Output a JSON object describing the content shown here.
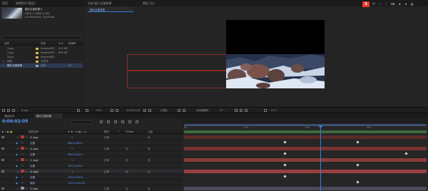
{
  "project": {
    "tab_label": "项目",
    "tab_label2": "效果控件 图层1",
    "thumb_title": "图片过渡效果 ▾",
    "thumb_meta": [
      "1920 × 1080 (1.00)",
      "Δ 0:00:05:00, 25.00 fps"
    ],
    "search_placeholder": "",
    "headers": [
      "名称",
      "类型",
      "大小",
      "帧速率"
    ],
    "items": [
      {
        "name": "1.jpg",
        "type": "ImporteJPG",
        "size": "912 KB",
        "color": "#d9b84f"
      },
      {
        "name": "2.jpg",
        "type": "ImporteJPG",
        "size": "895 KB",
        "color": "#d9b84f"
      },
      {
        "name": "3.jpg",
        "type": "ImporteJPG",
        "size": "",
        "color": "#d9b84f"
      },
      {
        "name": "纯色",
        "type": "文件夹",
        "size": "",
        "color": "#d9b84f"
      },
      {
        "name": "图片过渡效果",
        "type": "合成",
        "size": "25",
        "color": "#9c9cbf"
      }
    ],
    "footer_bpc": "8 bpc"
  },
  "viewer": {
    "tab_label": "合成 图片过渡效果",
    "tab_label2": "图层 (无)",
    "active_tab": "图片过渡效果",
    "brand_logo": "S",
    "toolbar": {
      "zoom": "50%",
      "timecode": "0:00:02:05",
      "resolution": "(完整)",
      "camera": "活动摄像机",
      "view": "1个...",
      "exposure": "+0.0"
    }
  },
  "timeline": {
    "tab_label": "渲染队列",
    "active_tab": "图片过渡效果",
    "timecode": "0:00:02:05",
    "headers": [
      "图层名称",
      "模式",
      "T",
      "TrkMat",
      "父级"
    ],
    "layers": [
      {
        "num": "1",
        "name": "[2.jpg]",
        "mode": "正常",
        "trk": "",
        "parent": "无",
        "type": "layer"
      },
      {
        "name": "位置",
        "value": "960.0,960.0",
        "type": "prop"
      },
      {
        "num": "2",
        "name": "[2.jpg]",
        "mode": "正常",
        "trk": "无",
        "parent": "无",
        "type": "layer"
      },
      {
        "name": "位置",
        "value": "960.0,540.0",
        "type": "prop"
      },
      {
        "num": "3",
        "name": "[1.jpg]",
        "mode": "正常",
        "trk": "无",
        "parent": "无",
        "type": "layer"
      },
      {
        "name": "位置",
        "value": "320.0,540.0",
        "type": "prop"
      },
      {
        "num": "4",
        "name": "[1.jpg]",
        "mode": "正常",
        "trk": "无",
        "parent": "无",
        "type": "layer"
      },
      {
        "name": "位置",
        "value": "278.0,393.0",
        "type": "prop"
      },
      {
        "name": "缩放",
        "value": "100.0,100.0%",
        "type": "prop"
      },
      {
        "num": "5",
        "name": "[3.jpg]",
        "mode": "正常",
        "trk": "无",
        "parent": "无",
        "type": "layer"
      }
    ],
    "ruler_labels": [
      "0s",
      "01s",
      "02s",
      "03s"
    ],
    "colors": {
      "accent": "#3a7be0",
      "track_red": "#b34a4a",
      "track_green": "#4a8f4a"
    }
  }
}
